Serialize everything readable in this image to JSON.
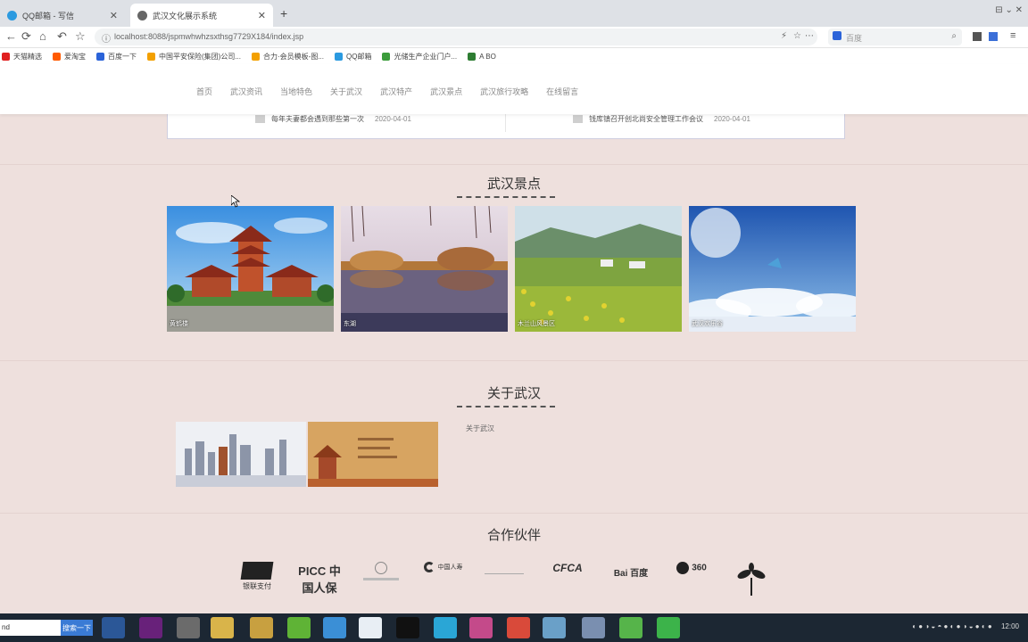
{
  "browser": {
    "tabs": [
      {
        "title": "QQ邮箱 - 写信"
      },
      {
        "title": "武汉文化展示系统"
      }
    ],
    "new_tab_symbol": "+",
    "url": "localhost:8088/jspmwhwhzsxthsg7729X184/index.jsp",
    "search_placeholder": "百度",
    "window_controls": "⊟  ⌄  ✕",
    "bookmarks": [
      {
        "label": "天猫精选",
        "color": "#e02020"
      },
      {
        "label": "爱淘宝",
        "color": "#ff5a00"
      },
      {
        "label": "百度一下",
        "color": "#2b63d9"
      },
      {
        "label": "中国平安保险(集团)公司...",
        "color": "#f3a000"
      },
      {
        "label": "合力·会员模板-图...",
        "color": "#f3a000"
      },
      {
        "label": "QQ邮箱",
        "color": "#2b9ae0"
      },
      {
        "label": "光储生产企业门户...",
        "color": "#3b9c3b"
      },
      {
        "label": "A BO",
        "color": "#2e7d32"
      }
    ]
  },
  "site": {
    "nav": [
      "首页",
      "武汉资讯",
      "当地特色",
      "关于武汉",
      "武汉特产",
      "武汉景点",
      "武汉旅行攻略",
      "在线留言"
    ],
    "news": [
      {
        "title": "每年夫妻都会遇到那些第一次",
        "date": "2020-04-01"
      },
      {
        "title": "钱库镇召开创北尚安全管理工作会议",
        "date": "2020-04-01"
      }
    ],
    "scenic_section_title": "武汉景点",
    "scenic_spots": [
      {
        "name": "黄鹤楼"
      },
      {
        "name": "东湖"
      },
      {
        "name": "木兰山风景区"
      },
      {
        "name": "武汉欢乐谷"
      }
    ],
    "about_section_title": "关于武汉",
    "about_text": "关于武汉",
    "partners_title": "合作伙伴",
    "partners": [
      "银联支付",
      "PICC 中国人保",
      "",
      "中国人寿",
      "",
      "CFCA",
      "Bai 百度",
      "360",
      ""
    ]
  },
  "taskbar": {
    "search_value": "nd",
    "search_button": "搜索一下",
    "clock": "12:00"
  }
}
